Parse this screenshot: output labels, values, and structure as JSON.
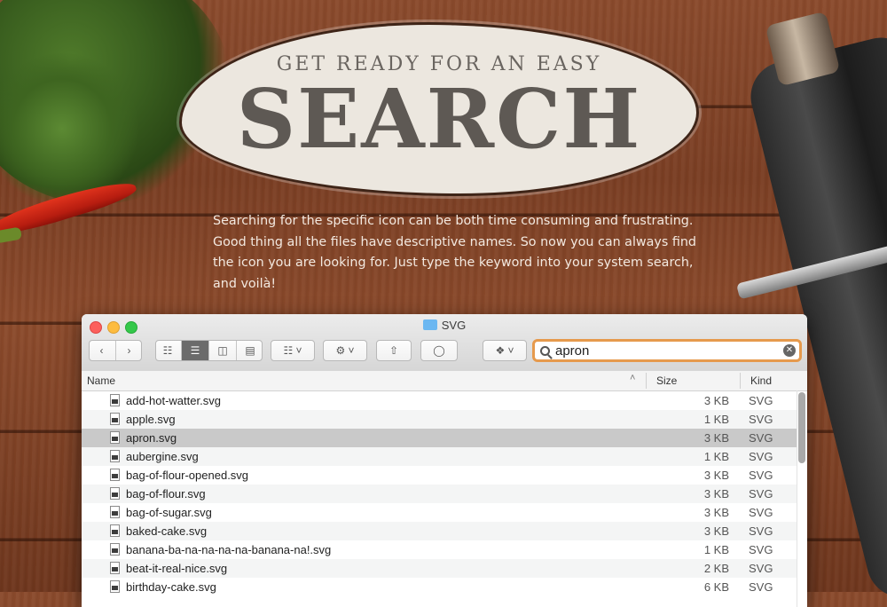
{
  "hero": {
    "subtitle": "GET READY FOR AN EASY",
    "title": "SEARCH",
    "description": "Searching for the specific icon can be both time consuming and frustrating. Good thing all the files have descriptive names. So now you can always find the icon you are looking for. Just type the keyword into your system search, and voilà!"
  },
  "window": {
    "title": "SVG",
    "search_value": "apron",
    "columns": {
      "name": "Name",
      "size": "Size",
      "kind": "Kind",
      "sort_indicator": "^"
    },
    "files": [
      {
        "name": "add-hot-watter.svg",
        "size": "3 KB",
        "kind": "SVG"
      },
      {
        "name": "apple.svg",
        "size": "1 KB",
        "kind": "SVG"
      },
      {
        "name": "apron.svg",
        "size": "3 KB",
        "kind": "SVG"
      },
      {
        "name": "aubergine.svg",
        "size": "1 KB",
        "kind": "SVG"
      },
      {
        "name": "bag-of-flour-opened.svg",
        "size": "3 KB",
        "kind": "SVG"
      },
      {
        "name": "bag-of-flour.svg",
        "size": "3 KB",
        "kind": "SVG"
      },
      {
        "name": "bag-of-sugar.svg",
        "size": "3 KB",
        "kind": "SVG"
      },
      {
        "name": "baked-cake.svg",
        "size": "3 KB",
        "kind": "SVG"
      },
      {
        "name": "banana-ba-na-na-na-na-banana-na!.svg",
        "size": "1 KB",
        "kind": "SVG"
      },
      {
        "name": "beat-it-real-nice.svg",
        "size": "2 KB",
        "kind": "SVG"
      },
      {
        "name": "birthday-cake.svg",
        "size": "6 KB",
        "kind": "SVG"
      }
    ],
    "selected_index": 2
  },
  "colors": {
    "accent_search_border": "#e69a4d",
    "selected_row": "#c9c9c9"
  }
}
